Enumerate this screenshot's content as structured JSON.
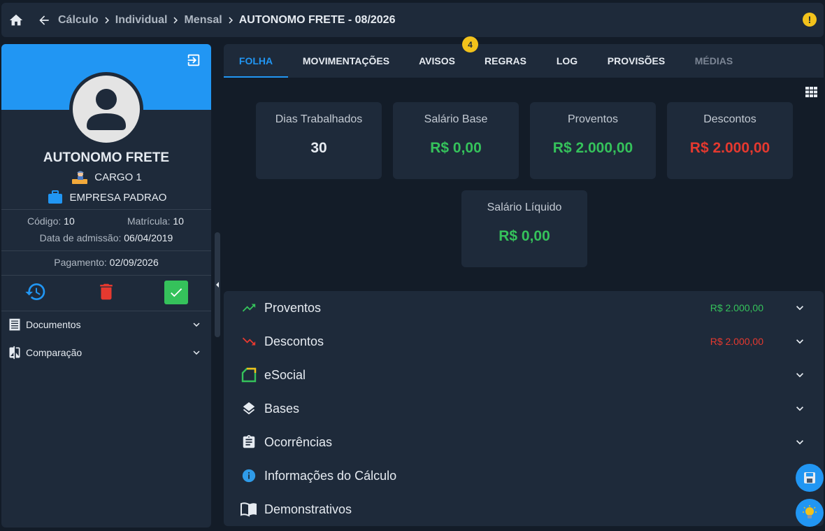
{
  "breadcrumb": {
    "items": [
      "Cálculo",
      "Individual",
      "Mensal"
    ],
    "current": "AUTONOMO FRETE - 08/2026"
  },
  "profile": {
    "name": "AUTONOMO FRETE",
    "cargo": "CARGO 1",
    "empresa": "EMPRESA PADRAO",
    "codigo_label": "Código:",
    "codigo": "10",
    "matricula_label": "Matrícula:",
    "matricula": "10",
    "admissao_label": "Data de admissão:",
    "admissao": "06/04/2019",
    "pagamento_label": "Pagamento:",
    "pagamento": "02/09/2026"
  },
  "side_menu": {
    "documentos": "Documentos",
    "comparacao": "Comparação"
  },
  "tabs": {
    "folha": "FOLHA",
    "movimentacoes": "MOVIMENTAÇÕES",
    "avisos": "AVISOS",
    "avisos_badge": "4",
    "regras": "REGRAS",
    "log": "LOG",
    "provisoes": "PROVISÕES",
    "medias": "MÉDIAS"
  },
  "summary": {
    "dias_title": "Dias Trabalhados",
    "dias_value": "30",
    "salario_base_title": "Salário Base",
    "salario_base_value": "R$ 0,00",
    "proventos_title": "Proventos",
    "proventos_value": "R$ 2.000,00",
    "descontos_title": "Descontos",
    "descontos_value": "R$ 2.000,00",
    "liquido_title": "Salário Líquido",
    "liquido_value": "R$ 0,00"
  },
  "sections": {
    "proventos": "Proventos",
    "proventos_value": "R$ 2.000,00",
    "descontos": "Descontos",
    "descontos_value": "R$ 2.000,00",
    "esocial": "eSocial",
    "bases": "Bases",
    "ocorrencias": "Ocorrências",
    "informacoes": "Informações do Cálculo",
    "demonstrativos": "Demonstrativos"
  },
  "colors": {
    "accent": "#2196f3",
    "positive": "#35c25b",
    "negative": "#e5392f",
    "warning": "#f2c21b"
  },
  "icons": [
    "home-icon",
    "arrow-left-icon",
    "chevron-right-icon",
    "warning-icon",
    "logout-icon",
    "user-avatar-icon",
    "worker-icon",
    "briefcase-icon",
    "history-icon",
    "trash-icon",
    "check-icon",
    "document-icon",
    "compare-icon",
    "chevron-down-icon",
    "grid-icon",
    "trending-up-icon",
    "trending-down-icon",
    "esocial-icon",
    "layers-icon",
    "clipboard-icon",
    "info-icon",
    "book-icon",
    "save-icon",
    "lightbulb-icon"
  ]
}
